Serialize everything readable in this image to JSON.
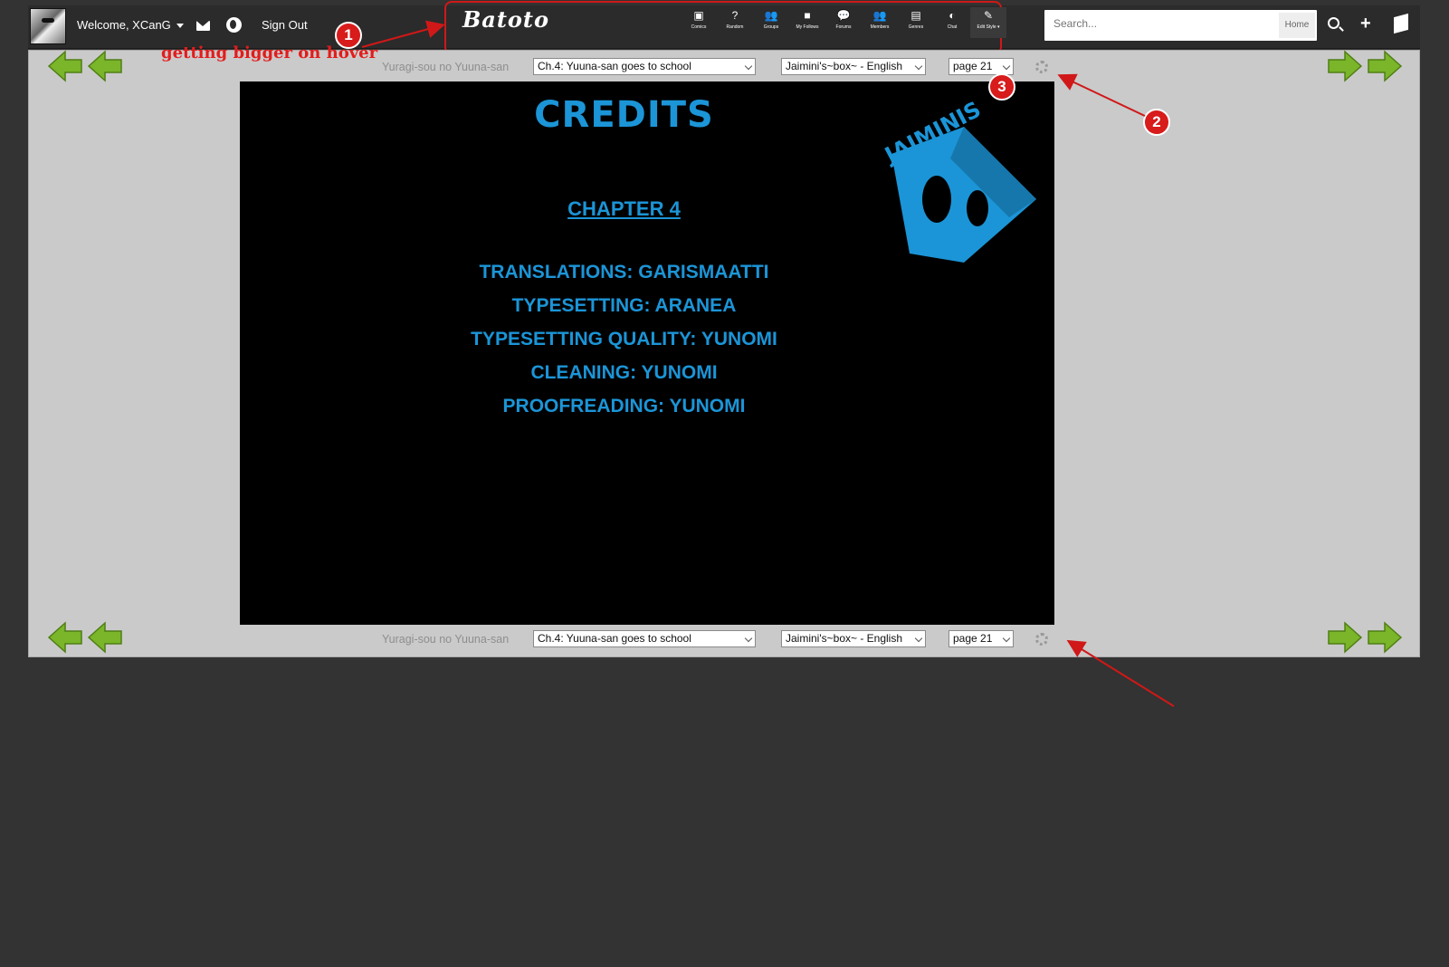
{
  "header": {
    "welcome": "Welcome, XCanG",
    "sign_out": "Sign Out",
    "logo": "Batoto",
    "nav": [
      {
        "label": "Comics",
        "icon": "comics-icon",
        "glyph": "▣"
      },
      {
        "label": "Random",
        "icon": "random-icon",
        "glyph": "?"
      },
      {
        "label": "Groups",
        "icon": "groups-icon",
        "glyph": "👥"
      },
      {
        "label": "My Follows",
        "icon": "follows-icon",
        "glyph": "■"
      },
      {
        "label": "Forums",
        "icon": "forums-icon",
        "glyph": "💬"
      },
      {
        "label": "Members",
        "icon": "members-icon",
        "glyph": "👥"
      },
      {
        "label": "Genres",
        "icon": "genres-icon",
        "glyph": "▤"
      },
      {
        "label": "Chat",
        "icon": "chat-icon",
        "glyph": "◐"
      },
      {
        "label": "Edit Style ▾",
        "icon": "brush-icon",
        "glyph": "✎"
      }
    ],
    "search_placeholder": "Search...",
    "search_scope": "Home"
  },
  "reader": {
    "manga_title": "Yuragi-sou no Yuuna-san",
    "chapter": "Ch.4: Yuuna-san goes to school",
    "group": "Jaimini's~box~ - English",
    "page": "page 21"
  },
  "page_image": {
    "title": "CREDITS",
    "chapter": "CHAPTER 4",
    "lines": [
      "TRANSLATIONS:  GARISMAATTI",
      "TYPESETTING: ARANEA",
      "TYPESETTING QUALITY: YUNOMI",
      "CLEANING: YUNOMI",
      "PROOFREADING: YUNOMI"
    ],
    "logo_text": "JAIMINIS"
  },
  "annotations": {
    "note": "getting bigger on hover",
    "badge1": "1",
    "badge2": "2",
    "badge3": "3"
  },
  "colors": {
    "accent_blue": "#1b95d7",
    "annotation_red": "#d81b1b",
    "arrow_green": "#7ab52a"
  }
}
